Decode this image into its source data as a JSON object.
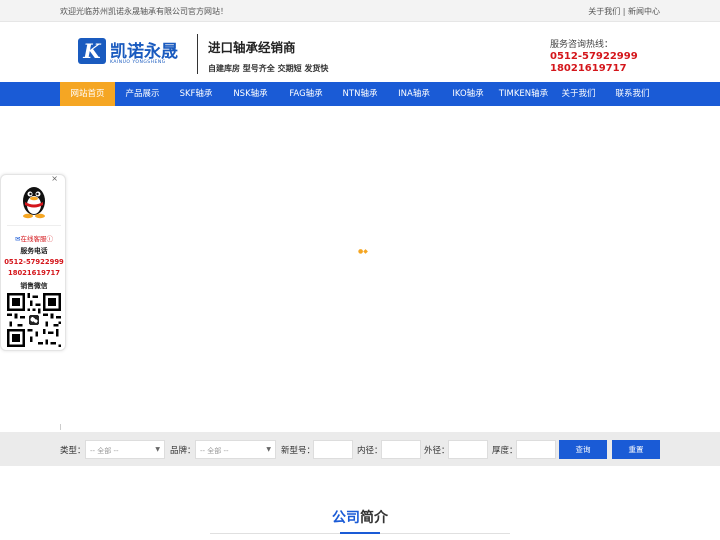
{
  "topbar": {
    "welcome": "欢迎光临苏州凯诺永晟轴承有限公司官方网站！",
    "link_about": "关于我们",
    "link_sep": " | ",
    "link_news": "新闻中心"
  },
  "header": {
    "logo_name": "凯诺永晟",
    "logo_sub": "KAINUO YONGSHENG",
    "logo_letter": "K",
    "slogan_main": "进口轴承经销商",
    "slogan_sub": "自建库房 型号齐全 交期短 发货快",
    "hotline_label": "服务咨询热线：",
    "hotline_phone1": "0512-57922999",
    "hotline_phone2": "18021619717"
  },
  "nav": {
    "items": [
      {
        "label": "网站首页",
        "active": true
      },
      {
        "label": "产品展示"
      },
      {
        "label": "SKF轴承"
      },
      {
        "label": "NSK轴承"
      },
      {
        "label": "FAG轴承"
      },
      {
        "label": "NTN轴承"
      },
      {
        "label": "INA轴承"
      },
      {
        "label": "IKO轴承"
      },
      {
        "label": "TIMKEN轴承"
      },
      {
        "label": "关于我们"
      },
      {
        "label": "联系我们"
      }
    ]
  },
  "search": {
    "type_label": "类型：",
    "type_value": "-- 全部 --",
    "brand_label": "品牌：",
    "brand_value": "-- 全部 --",
    "model_label": "新型号：",
    "inner_label": "内径：",
    "outer_label": "外径：",
    "thick_label": "厚度：",
    "query_button": "查询",
    "reset_button": "重置"
  },
  "section": {
    "title_highlight": "公司",
    "title_rest": "简介"
  },
  "float_panel": {
    "close": "×",
    "online_service": "在线客服",
    "service_phone_label": "服务电话",
    "phone1": "0512-57922999",
    "phone2": "18021619717",
    "wechat_label": "销售微信"
  },
  "colors": {
    "nav_bg": "#1a5bd6",
    "nav_active": "#f5a623",
    "phone_red": "#d4161b",
    "brand_blue": "#1a5bbf"
  }
}
